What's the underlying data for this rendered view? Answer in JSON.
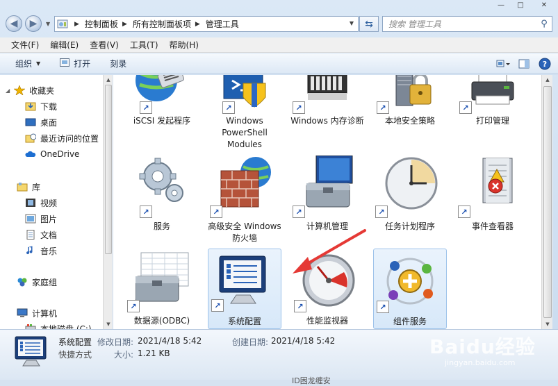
{
  "window": {
    "title_controls": [
      "minimize",
      "maximize",
      "close"
    ]
  },
  "address": {
    "crumbs": [
      "控制面板",
      "所有控制面板项",
      "管理工具"
    ]
  },
  "search": {
    "placeholder": "搜索 管理工具"
  },
  "menu": [
    "文件(F)",
    "编辑(E)",
    "查看(V)",
    "工具(T)",
    "帮助(H)"
  ],
  "commands": {
    "organize": "组织",
    "open": "打开",
    "burn": "刻录"
  },
  "navpane": {
    "favorites": "收藏夹",
    "downloads": "下载",
    "desktop": "桌面",
    "recent": "最近访问的位置",
    "onedrive": "OneDrive",
    "libraries": "库",
    "videos": "视频",
    "pictures": "图片",
    "documents": "文档",
    "music": "音乐",
    "homegroup": "家庭组",
    "computer": "计算机",
    "localdisk": "本地磁盘 (C:)"
  },
  "items": [
    {
      "label": "iSCSI 发起程序",
      "icon": "globe-network-icon"
    },
    {
      "label": "Windows PowerShell Modules",
      "icon": "powershell-icon"
    },
    {
      "label": "Windows 内存诊断",
      "icon": "memory-chip-icon"
    },
    {
      "label": "本地安全策略",
      "icon": "padlock-server-icon"
    },
    {
      "label": "打印管理",
      "icon": "printer-icon"
    },
    {
      "label": "服务",
      "icon": "gears-icon"
    },
    {
      "label": "高级安全 Windows 防火墙",
      "icon": "firewall-icon"
    },
    {
      "label": "计算机管理",
      "icon": "computer-toolbox-icon"
    },
    {
      "label": "任务计划程序",
      "icon": "clock-icon"
    },
    {
      "label": "事件查看器",
      "icon": "event-log-icon"
    },
    {
      "label": "数据源(ODBC)",
      "icon": "datasource-icon"
    },
    {
      "label": "系统配置",
      "icon": "system-config-icon"
    },
    {
      "label": "性能监视器",
      "icon": "gauge-icon"
    },
    {
      "label": "组件服务",
      "icon": "component-services-icon"
    }
  ],
  "selected_item": "系统配置",
  "details": {
    "name": "系统配置",
    "type": "快捷方式",
    "modified_label": "修改日期:",
    "modified_value": "2021/4/18 5:42",
    "created_label": "创建日期:",
    "created_value": "2021/4/18 5:42",
    "size_label": "大小:",
    "size_value": "1.21 KB"
  },
  "watermark": {
    "text": "Baidu经验",
    "url": "jingyan.baidu.com"
  },
  "bottom_text": "ID困龙缠安",
  "colors": {
    "accent": "#2c5f9e",
    "selection": "#d7e8f9",
    "arrow": "#e53935"
  }
}
